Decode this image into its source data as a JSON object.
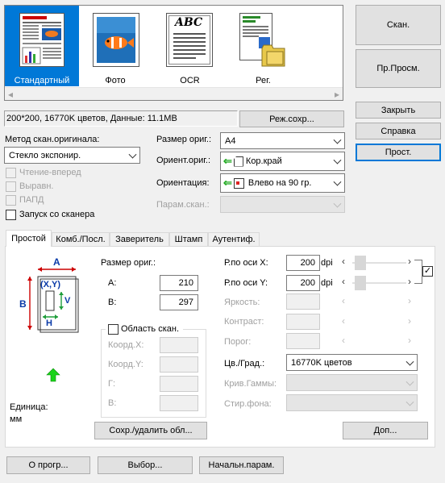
{
  "presets": [
    {
      "label": "Стандартный",
      "selected": true
    },
    {
      "label": "Фото",
      "selected": false
    },
    {
      "label": "OCR",
      "selected": false
    },
    {
      "label": "Рег.",
      "selected": false
    }
  ],
  "status_text": "200*200, 16770K цветов, Данные: 11.1MB",
  "buttons": {
    "save_mode": "Реж.сохр...",
    "scan": "Скан.",
    "preview": "Пр.Просм.",
    "close": "Закрыть",
    "help": "Справка",
    "simple": "Прост.",
    "save_delete_area": "Сохр./удалить обл...",
    "more": "Доп...",
    "about": "О прогр...",
    "select": "Выбор...",
    "defaults": "Начальн.парам."
  },
  "scan_method": {
    "label": "Метод скан.оригинала:",
    "value": "Стекло экспонир."
  },
  "checks": {
    "read_ahead": "Чтение-вперед",
    "align": "Выравн.",
    "adf": "ПАПД",
    "start_from_scanner": "Запуск со сканера",
    "scan_area": "Область скан."
  },
  "orig_size": {
    "label": "Размер ориг.:",
    "value": "A4"
  },
  "orig_orient": {
    "label": "Ориент.ориг.:",
    "value": "Кор.край"
  },
  "orientation": {
    "label": "Ориентация:",
    "value": "Влево на 90 гр."
  },
  "scan_params": {
    "label": "Парам.скан.:",
    "value": ""
  },
  "tabs": [
    "Простой",
    "Комб./Посл.",
    "Заверитель",
    "Штамп",
    "Аутентиф."
  ],
  "diagram": {
    "a": "A",
    "b": "B",
    "xy": "(X,Y)",
    "v": "V",
    "h": "H"
  },
  "unit": {
    "label": "Единица:",
    "value": "мм"
  },
  "size_panel": {
    "title": "Размер ориг.:",
    "a_label": "A:",
    "a_value": "210",
    "b_label": "B:",
    "b_value": "297"
  },
  "coords": {
    "x": "Коорд.X:",
    "y": "Коорд.Y:",
    "g": "Г:",
    "v": "В:"
  },
  "resolution": {
    "x_label": "Р.по оси X:",
    "x_value": "200",
    "y_label": "Р.по оси Y:",
    "y_value": "200",
    "unit": "dpi"
  },
  "adjust": {
    "brightness": "Яркость:",
    "contrast": "Контраст:",
    "threshold": "Порог:"
  },
  "color": {
    "label": "Цв./Град.:",
    "value": "16770K цветов"
  },
  "gamma": {
    "label": "Крив.Гаммы:"
  },
  "bg_erase": {
    "label": "Стир.фона:"
  },
  "sym": {
    "left": "‹",
    "right": "›"
  }
}
